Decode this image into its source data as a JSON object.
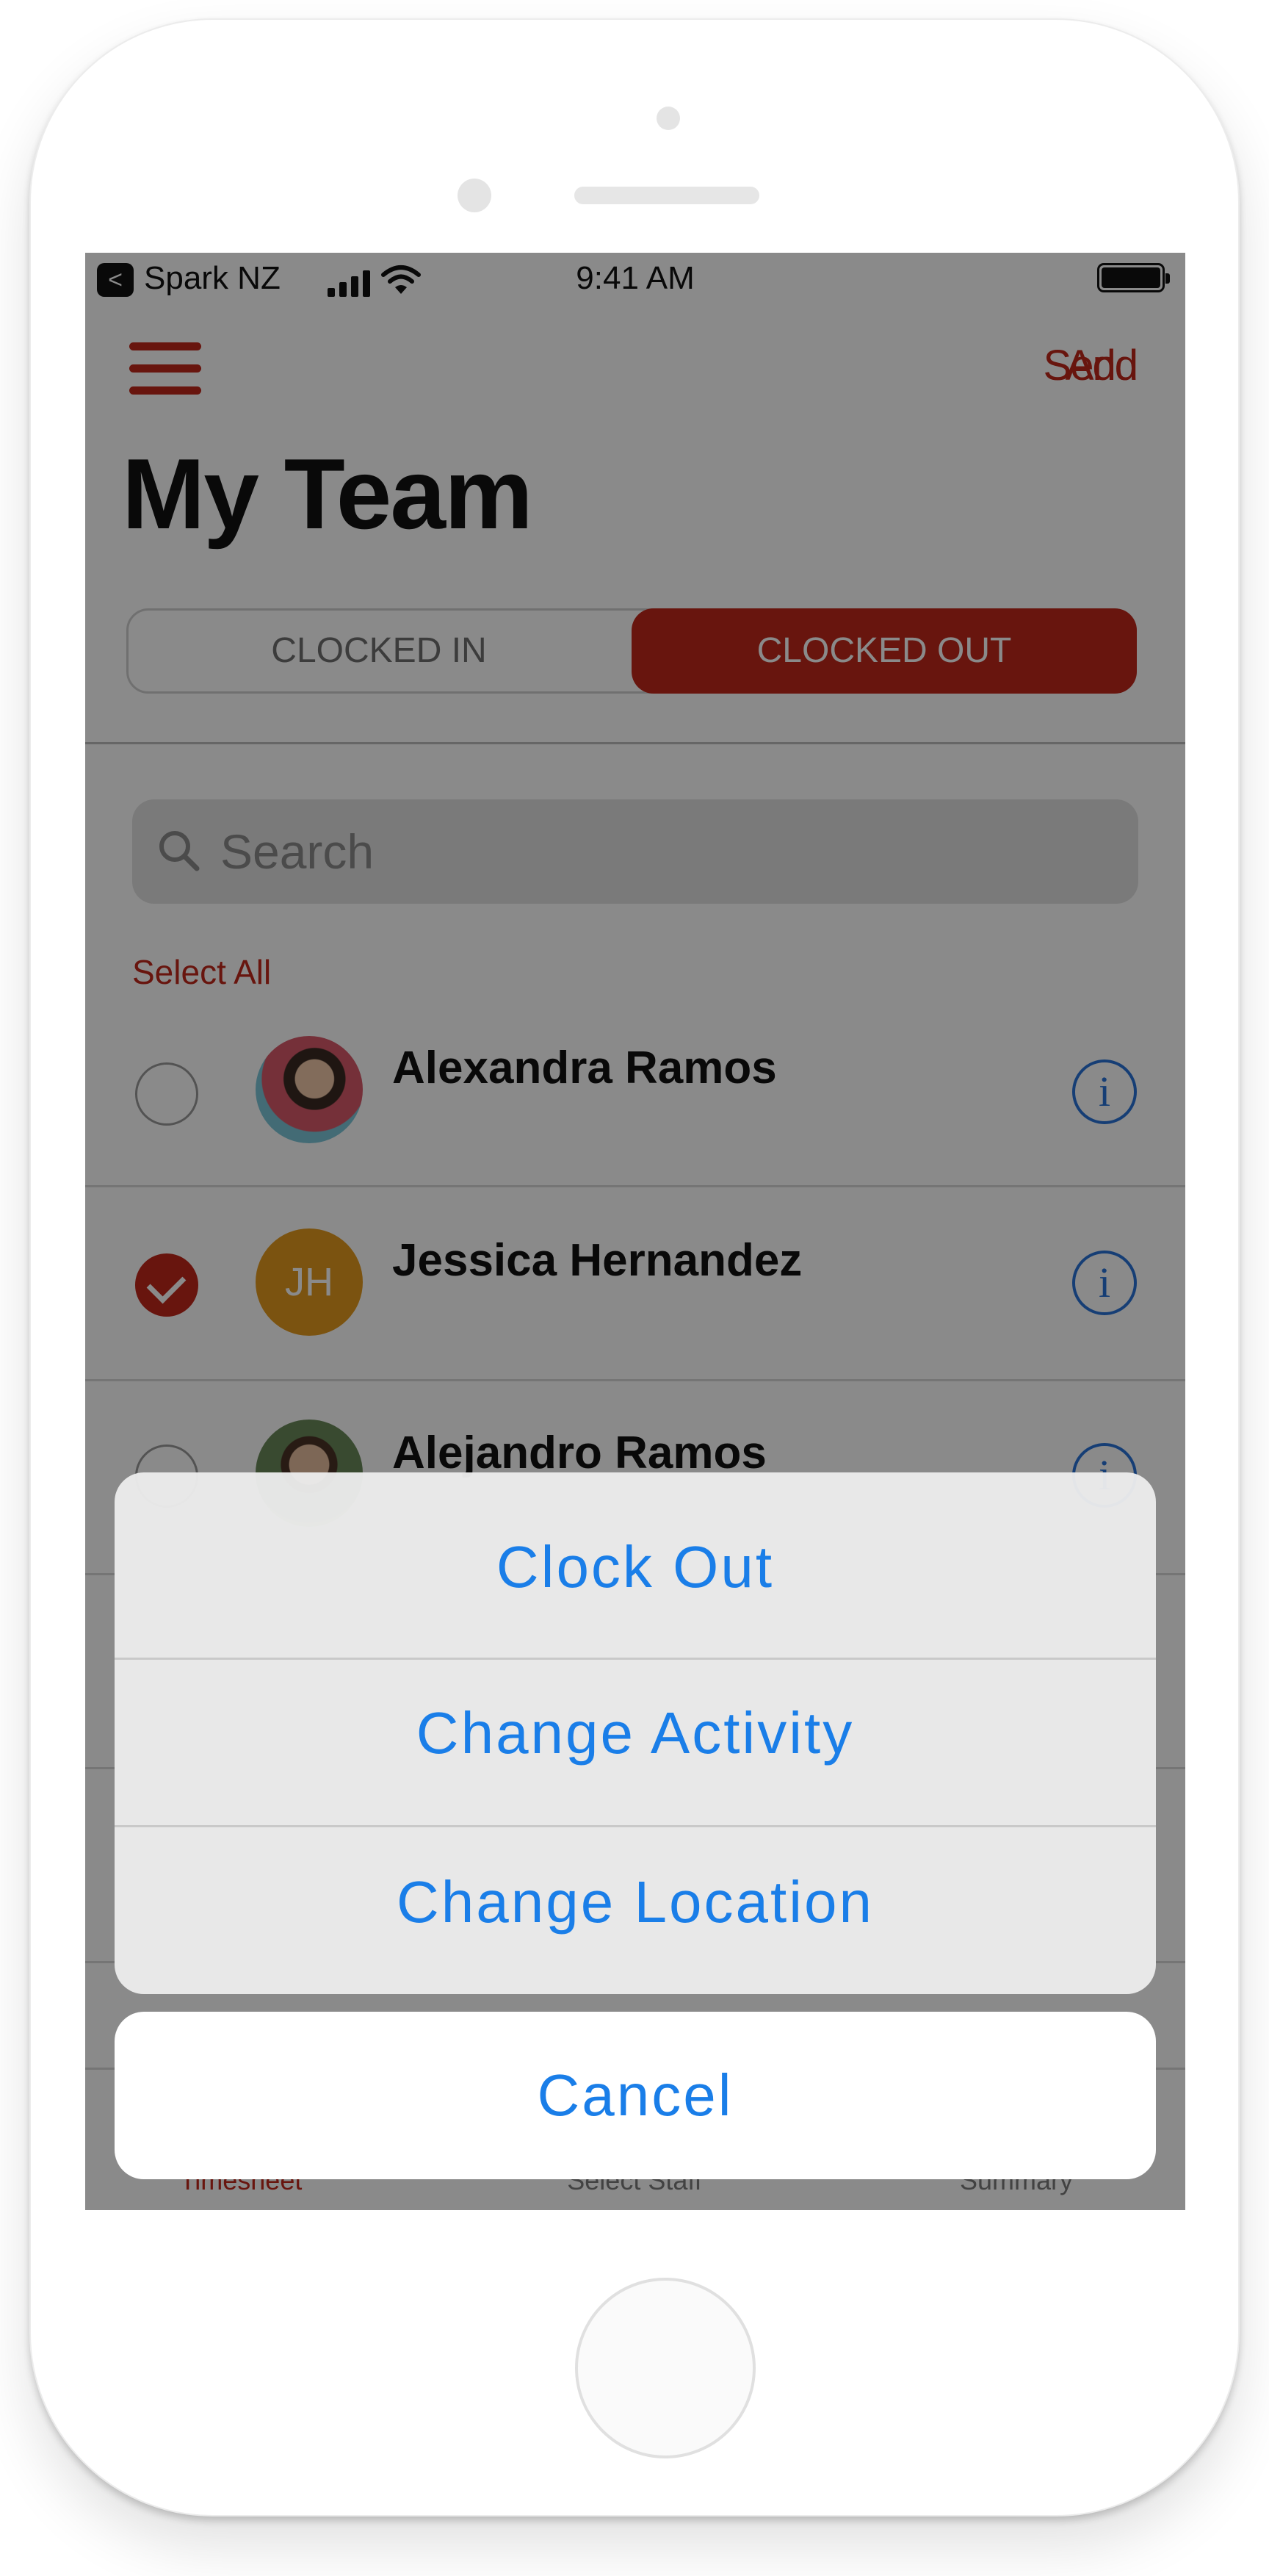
{
  "status_bar": {
    "back_glyph": "<",
    "carrier": "Spark NZ",
    "time": "9:41 AM"
  },
  "nav": {
    "right_labels": [
      "Send",
      "Add"
    ]
  },
  "page_title": "My Team",
  "segments": {
    "clocked_in": "CLOCKED IN",
    "clocked_out": "CLOCKED OUT",
    "selected": "CLOCKED OUT"
  },
  "search": {
    "placeholder": "Search"
  },
  "select_all": "Select All",
  "staff": [
    {
      "name": "Alexandra Ramos",
      "avatar": "photo",
      "selected": false
    },
    {
      "name": "Jessica Hernandez",
      "avatar": "initials",
      "initials": "JH",
      "selected": true
    },
    {
      "name": "Alejandro Ramos",
      "avatar": "photo",
      "selected": false
    }
  ],
  "info_glyph": "i",
  "tabs": [
    {
      "label": "Timesheet",
      "active": true
    },
    {
      "label": "Select Staff",
      "active": false
    },
    {
      "label": "Summary",
      "active": false
    }
  ],
  "action_sheet": {
    "actions": [
      "Clock Out",
      "Change Activity",
      "Change Location"
    ],
    "cancel": "Cancel"
  },
  "colors": {
    "brand_red": "#c0271b",
    "ios_blue": "#1a7ee8",
    "avatar_orange": "#e49a1f"
  }
}
